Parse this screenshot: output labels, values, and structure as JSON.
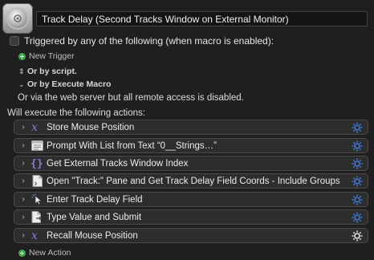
{
  "macro": {
    "title": "Track Delay (Second Tracks Window on External Monitor)"
  },
  "triggers": {
    "checkbox_label": "Triggered by any of the following (when macro is enabled):",
    "new_trigger": "New Trigger",
    "or_script": "Or by script.",
    "or_execute_macro": "Or by Execute Macro",
    "web_server_note": "Or via the web server but all remote access is disabled."
  },
  "actions": {
    "header": "Will execute the following actions:",
    "items": [
      {
        "label": "Store Mouse Position",
        "icon": "variable-x-icon"
      },
      {
        "label": "Prompt With List from Text “0__Strings…”",
        "icon": "window-list-icon"
      },
      {
        "label": "Get External Tracks Window Index",
        "icon": "json-braces-icon"
      },
      {
        "label": "Open \"Track:\" Pane and Get Track Delay Field Coords - Include Groups",
        "icon": "script-file-icon"
      },
      {
        "label": "Enter Track Delay Field",
        "icon": "mouse-click-icon"
      },
      {
        "label": "Type Value and Submit",
        "icon": "document-arrow-icon"
      },
      {
        "label": "Recall Mouse Position",
        "icon": "variable-x-icon"
      }
    ],
    "new_action": "New Action"
  },
  "colors": {
    "gear_blue": "#3d7bd9",
    "variable_purple": "#8a7bd6",
    "add_green": "#3faa4a"
  }
}
